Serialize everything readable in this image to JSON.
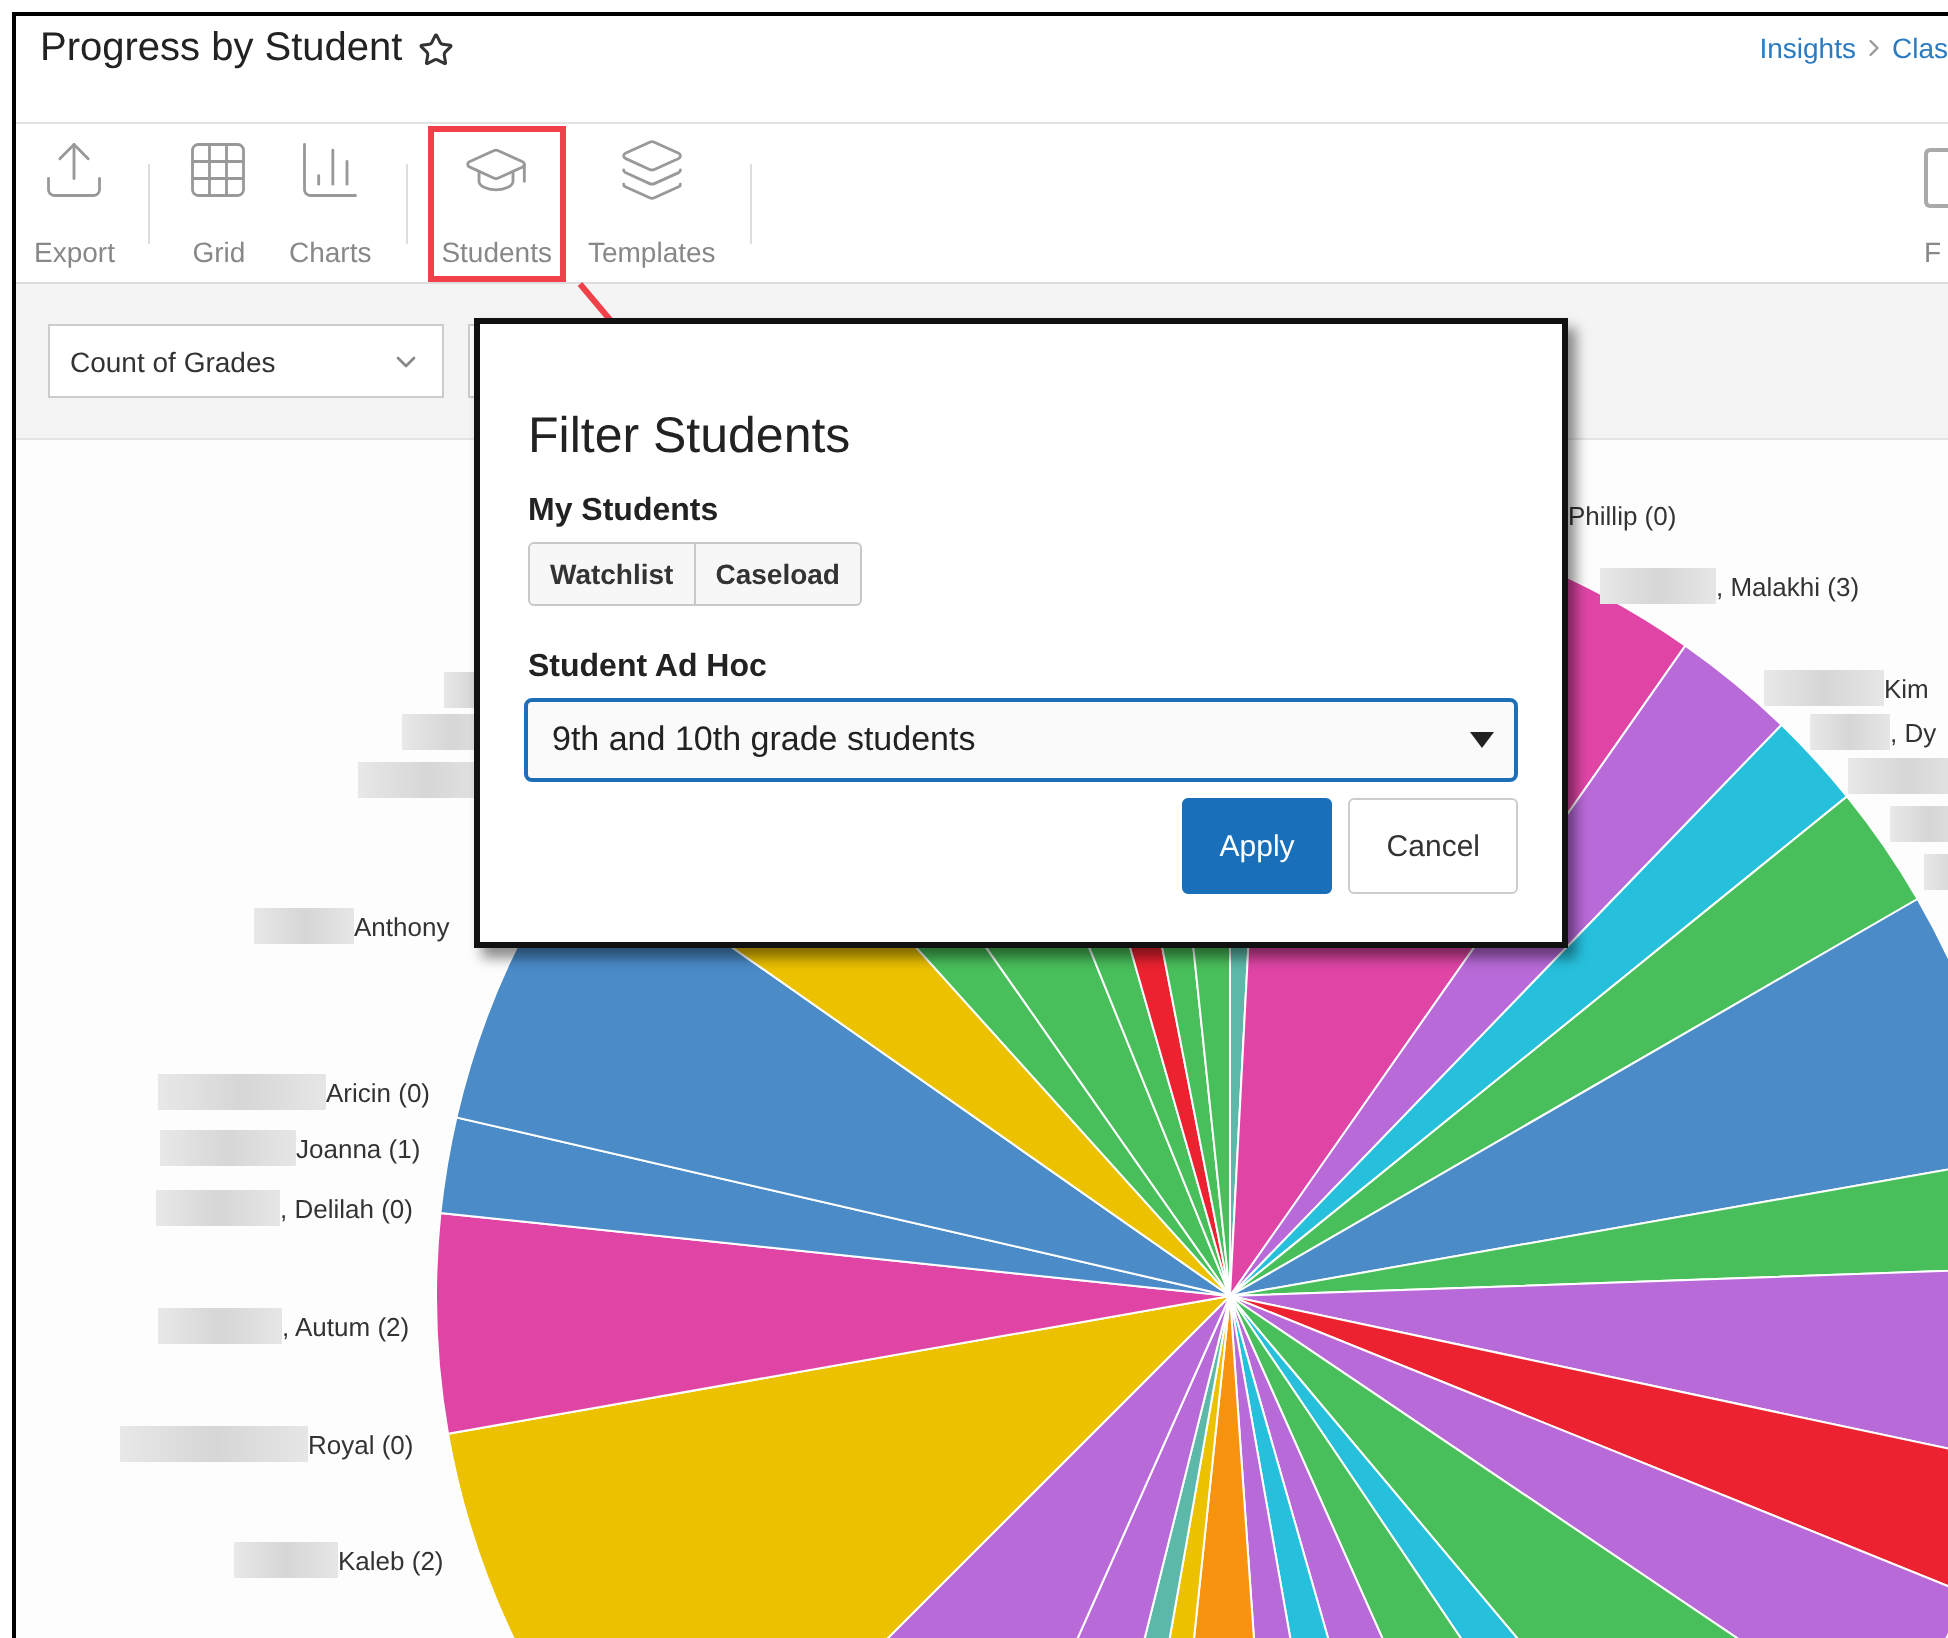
{
  "header": {
    "title": "Progress by Student",
    "favorite": false,
    "breadcrumb": [
      "Insights",
      "Clas"
    ]
  },
  "toolbar": [
    {
      "label": "Export",
      "highlighted": false
    },
    {
      "label": "Grid",
      "highlighted": false
    },
    {
      "label": "Charts",
      "highlighted": false
    },
    {
      "label": "Students",
      "highlighted": true
    },
    {
      "label": "Templates",
      "highlighted": false
    }
  ],
  "toolbar_right": {
    "label": "F"
  },
  "filters": {
    "measure": "Count of Grades"
  },
  "chart": {
    "labels": [
      "Anthony",
      "Aricin (0)",
      "Joanna (1)",
      ", Delilah (0)",
      ", Autum (2)",
      "Royal (0)",
      "Kaleb (2)",
      "Phillip (0)",
      ", Malakhi (3)",
      "Kim",
      ", Dy"
    ]
  },
  "dialog": {
    "title": "Filter Students",
    "my_students_label": "My Students",
    "my_students_buttons": [
      "Watchlist",
      "Caseload"
    ],
    "ad_hoc_label": "Student Ad Hoc",
    "ad_hoc_value": "9th and 10th grade students",
    "buttons": [
      {
        "label": "Apply",
        "kind": "primary"
      },
      {
        "label": "Cancel",
        "kind": "secondary"
      }
    ]
  }
}
